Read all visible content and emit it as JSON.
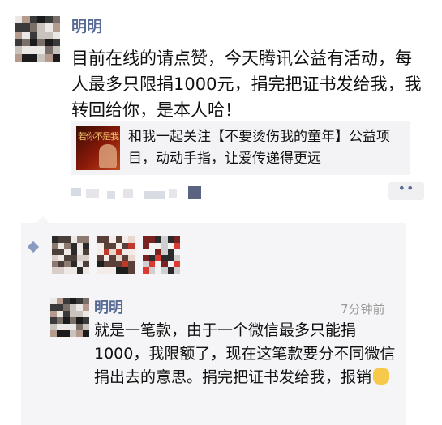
{
  "post": {
    "author": "明明",
    "text": "目前在线的请点赞，今天腾讯公益有活动，每人最多只限捐1000元，捐完把证书发给我，我转回给你，是本人哈！",
    "share_card": {
      "thumbnail_text": "若你不是我",
      "title": "和我一起关注【不要烫伤我的童年】公益项目，动动手指，让爱传递得更远"
    },
    "more_button": "••"
  },
  "likes": {
    "icon": "heart-icon",
    "avatar_count": 3
  },
  "comment": {
    "author": "明明",
    "time": "7分钟前",
    "text": "就是一笔款，由于一个微信最多只能捐1000，我限额了，现在这笔款要分不同微信捐出去的意思。捐完把证书发给我，报销",
    "emoji": "ok-hand-emoji"
  },
  "colors": {
    "name_blue": "#576b95",
    "comment_bg": "#f5f5f7",
    "time_gray": "#9a9a9a"
  }
}
